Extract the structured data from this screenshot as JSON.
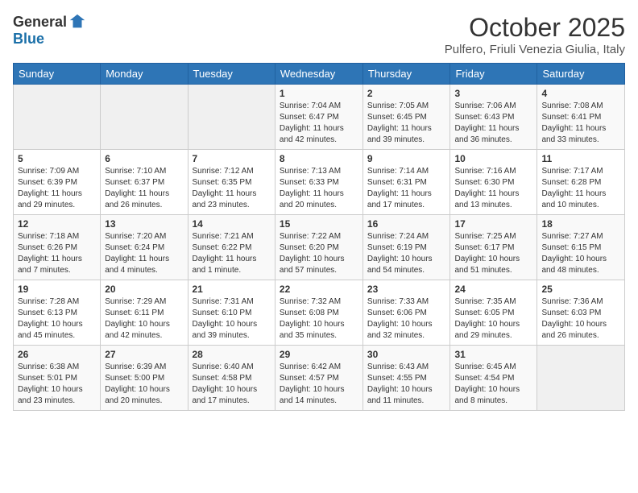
{
  "logo": {
    "general": "General",
    "blue": "Blue"
  },
  "title": "October 2025",
  "location": "Pulfero, Friuli Venezia Giulia, Italy",
  "days_of_week": [
    "Sunday",
    "Monday",
    "Tuesday",
    "Wednesday",
    "Thursday",
    "Friday",
    "Saturday"
  ],
  "weeks": [
    [
      {
        "day": "",
        "info": ""
      },
      {
        "day": "",
        "info": ""
      },
      {
        "day": "",
        "info": ""
      },
      {
        "day": "1",
        "info": "Sunrise: 7:04 AM\nSunset: 6:47 PM\nDaylight: 11 hours and 42 minutes."
      },
      {
        "day": "2",
        "info": "Sunrise: 7:05 AM\nSunset: 6:45 PM\nDaylight: 11 hours and 39 minutes."
      },
      {
        "day": "3",
        "info": "Sunrise: 7:06 AM\nSunset: 6:43 PM\nDaylight: 11 hours and 36 minutes."
      },
      {
        "day": "4",
        "info": "Sunrise: 7:08 AM\nSunset: 6:41 PM\nDaylight: 11 hours and 33 minutes."
      }
    ],
    [
      {
        "day": "5",
        "info": "Sunrise: 7:09 AM\nSunset: 6:39 PM\nDaylight: 11 hours and 29 minutes."
      },
      {
        "day": "6",
        "info": "Sunrise: 7:10 AM\nSunset: 6:37 PM\nDaylight: 11 hours and 26 minutes."
      },
      {
        "day": "7",
        "info": "Sunrise: 7:12 AM\nSunset: 6:35 PM\nDaylight: 11 hours and 23 minutes."
      },
      {
        "day": "8",
        "info": "Sunrise: 7:13 AM\nSunset: 6:33 PM\nDaylight: 11 hours and 20 minutes."
      },
      {
        "day": "9",
        "info": "Sunrise: 7:14 AM\nSunset: 6:31 PM\nDaylight: 11 hours and 17 minutes."
      },
      {
        "day": "10",
        "info": "Sunrise: 7:16 AM\nSunset: 6:30 PM\nDaylight: 11 hours and 13 minutes."
      },
      {
        "day": "11",
        "info": "Sunrise: 7:17 AM\nSunset: 6:28 PM\nDaylight: 11 hours and 10 minutes."
      }
    ],
    [
      {
        "day": "12",
        "info": "Sunrise: 7:18 AM\nSunset: 6:26 PM\nDaylight: 11 hours and 7 minutes."
      },
      {
        "day": "13",
        "info": "Sunrise: 7:20 AM\nSunset: 6:24 PM\nDaylight: 11 hours and 4 minutes."
      },
      {
        "day": "14",
        "info": "Sunrise: 7:21 AM\nSunset: 6:22 PM\nDaylight: 11 hours and 1 minute."
      },
      {
        "day": "15",
        "info": "Sunrise: 7:22 AM\nSunset: 6:20 PM\nDaylight: 10 hours and 57 minutes."
      },
      {
        "day": "16",
        "info": "Sunrise: 7:24 AM\nSunset: 6:19 PM\nDaylight: 10 hours and 54 minutes."
      },
      {
        "day": "17",
        "info": "Sunrise: 7:25 AM\nSunset: 6:17 PM\nDaylight: 10 hours and 51 minutes."
      },
      {
        "day": "18",
        "info": "Sunrise: 7:27 AM\nSunset: 6:15 PM\nDaylight: 10 hours and 48 minutes."
      }
    ],
    [
      {
        "day": "19",
        "info": "Sunrise: 7:28 AM\nSunset: 6:13 PM\nDaylight: 10 hours and 45 minutes."
      },
      {
        "day": "20",
        "info": "Sunrise: 7:29 AM\nSunset: 6:11 PM\nDaylight: 10 hours and 42 minutes."
      },
      {
        "day": "21",
        "info": "Sunrise: 7:31 AM\nSunset: 6:10 PM\nDaylight: 10 hours and 39 minutes."
      },
      {
        "day": "22",
        "info": "Sunrise: 7:32 AM\nSunset: 6:08 PM\nDaylight: 10 hours and 35 minutes."
      },
      {
        "day": "23",
        "info": "Sunrise: 7:33 AM\nSunset: 6:06 PM\nDaylight: 10 hours and 32 minutes."
      },
      {
        "day": "24",
        "info": "Sunrise: 7:35 AM\nSunset: 6:05 PM\nDaylight: 10 hours and 29 minutes."
      },
      {
        "day": "25",
        "info": "Sunrise: 7:36 AM\nSunset: 6:03 PM\nDaylight: 10 hours and 26 minutes."
      }
    ],
    [
      {
        "day": "26",
        "info": "Sunrise: 6:38 AM\nSunset: 5:01 PM\nDaylight: 10 hours and 23 minutes."
      },
      {
        "day": "27",
        "info": "Sunrise: 6:39 AM\nSunset: 5:00 PM\nDaylight: 10 hours and 20 minutes."
      },
      {
        "day": "28",
        "info": "Sunrise: 6:40 AM\nSunset: 4:58 PM\nDaylight: 10 hours and 17 minutes."
      },
      {
        "day": "29",
        "info": "Sunrise: 6:42 AM\nSunset: 4:57 PM\nDaylight: 10 hours and 14 minutes."
      },
      {
        "day": "30",
        "info": "Sunrise: 6:43 AM\nSunset: 4:55 PM\nDaylight: 10 hours and 11 minutes."
      },
      {
        "day": "31",
        "info": "Sunrise: 6:45 AM\nSunset: 4:54 PM\nDaylight: 10 hours and 8 minutes."
      },
      {
        "day": "",
        "info": ""
      }
    ]
  ]
}
